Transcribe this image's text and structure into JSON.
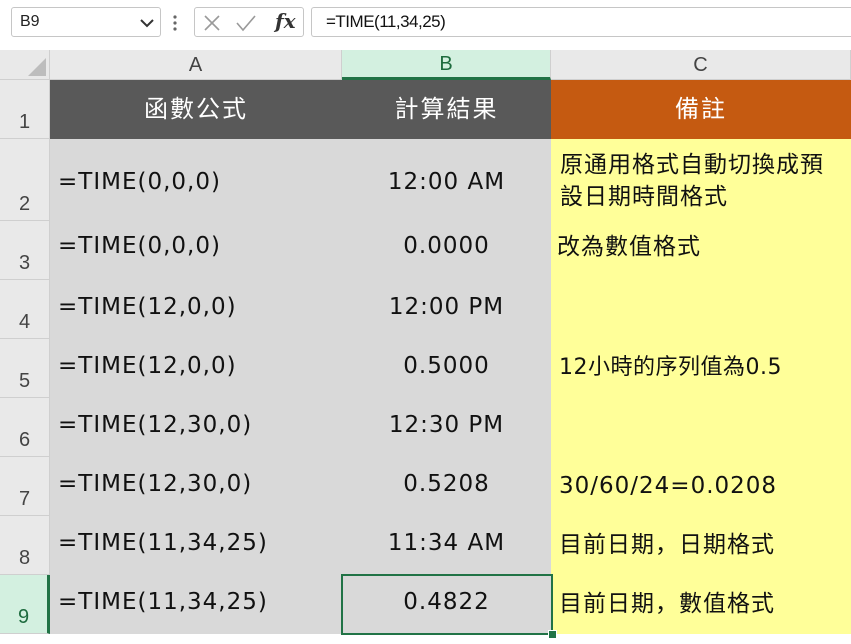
{
  "namebox": {
    "value": "B9",
    "icon": "chevron-down-icon"
  },
  "formula_bar": {
    "cancel_icon": "cancel-icon",
    "enter_icon": "checkmark-icon",
    "fx_label": "fx",
    "formula": "=TIME(11,34,25)"
  },
  "columns": [
    "A",
    "B",
    "C"
  ],
  "selected_column": "B",
  "selected_row": "9",
  "rows": [
    {
      "num": "1",
      "a": "函數公式",
      "b": "計算結果",
      "c": "備註"
    },
    {
      "num": "2",
      "a": "=TIME(0,0,0)",
      "b": "12:00 AM",
      "c": "原通用格式自動切換成預設日期時間格式"
    },
    {
      "num": "3",
      "a": "=TIME(0,0,0)",
      "b": "0.0000",
      "c": "改為數值格式"
    },
    {
      "num": "4",
      "a": "=TIME(12,0,0)",
      "b": "12:00 PM",
      "c": ""
    },
    {
      "num": "5",
      "a": "=TIME(12,0,0)",
      "b": "0.5000",
      "c": "12小時的序列值為0.5"
    },
    {
      "num": "6",
      "a": "=TIME(12,30,0)",
      "b": "12:30 PM",
      "c": ""
    },
    {
      "num": "7",
      "a": "=TIME(12,30,0)",
      "b": "0.5208",
      "c": "30/60/24=0.0208"
    },
    {
      "num": "8",
      "a": "=TIME(11,34,25)",
      "b": "11:34 AM",
      "c": "目前日期，日期格式"
    },
    {
      "num": "9",
      "a": "=TIME(11,34,25)",
      "b": "0.4822",
      "c": "目前日期，數值格式"
    }
  ],
  "colors": {
    "header_dark": "#595959",
    "header_accent": "#c55a11",
    "cell_gray": "#d9d9d9",
    "cell_yellow": "#ffff99",
    "selection": "#217346"
  }
}
